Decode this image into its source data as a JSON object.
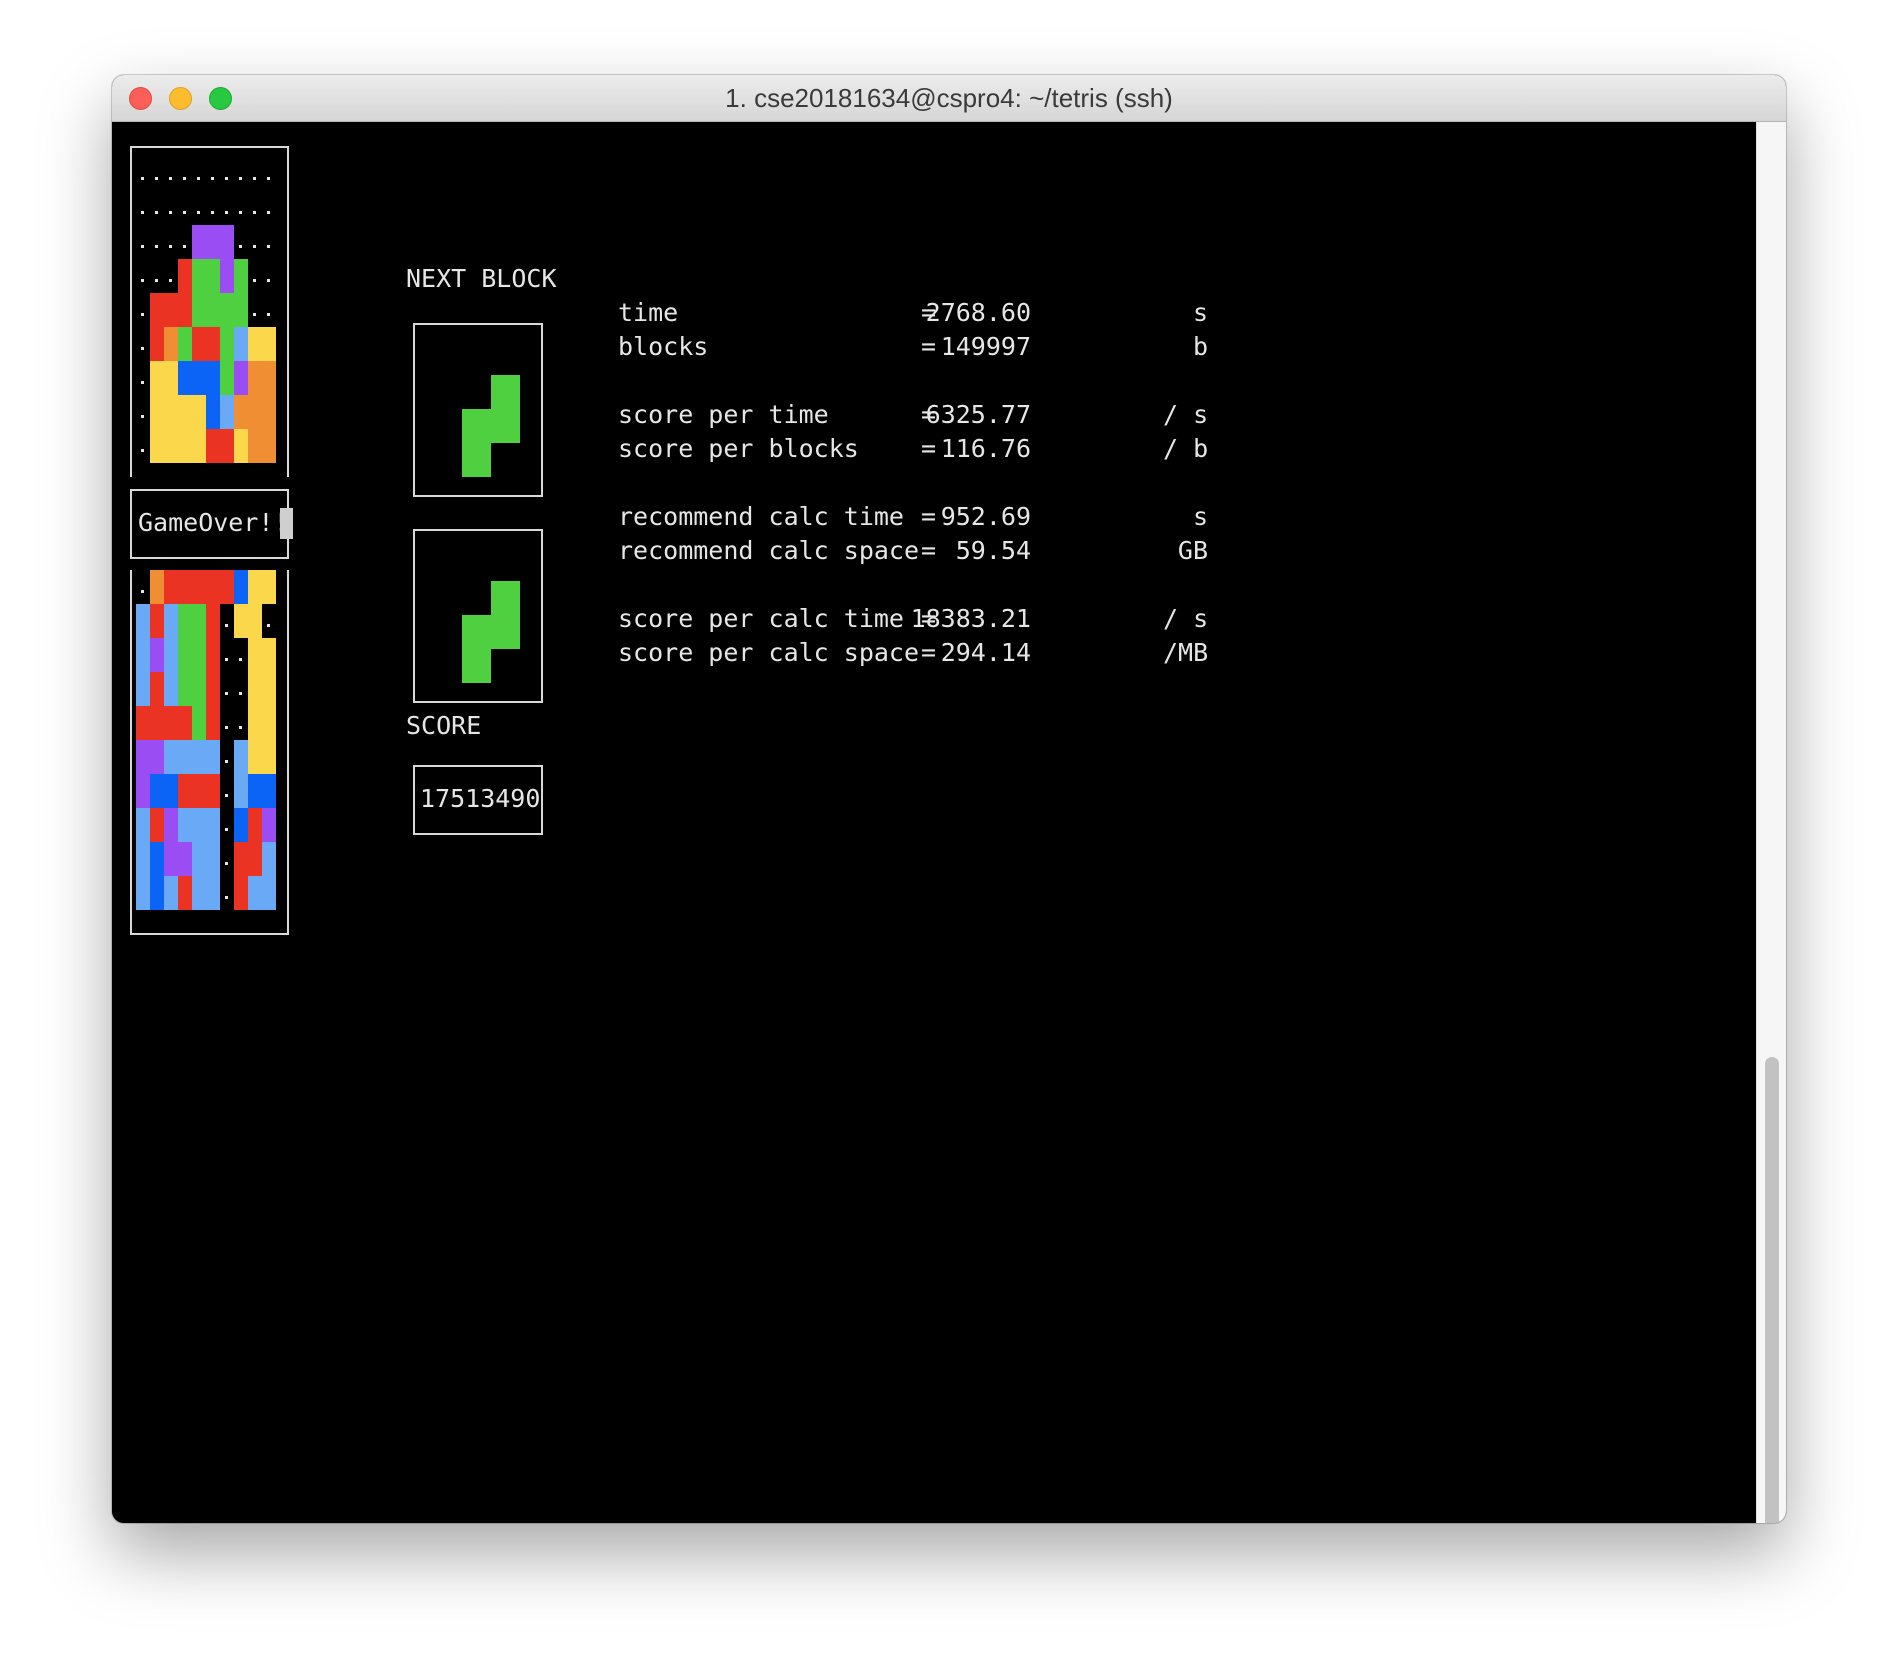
{
  "window": {
    "title": "1. cse20181634@cspro4: ~/tetris (ssh)"
  },
  "colors": {
    "R": "#ea3323",
    "O": "#f08e34",
    "Y": "#fbd84b",
    "G": "#4ed040",
    "B": "#0b64f6",
    "L": "#6aa9f6",
    "P": "#9a4df3",
    "terminal_bg": "#000000",
    "terminal_fg": "#e6e6e6"
  },
  "board_top": {
    "rows": [
      "..........",
      "..........",
      "....PPP...",
      "...RGGPG..",
      ".RRRGGGG..",
      ".ROGRRGLYY",
      ".YYBBBGPOO",
      ".YYYYBLOOO",
      ".YYYYRRYOO"
    ]
  },
  "game_over_label": "GameOver!!",
  "board_bottom": {
    "rows": [
      ".ORRRRRBYY",
      "LRLGGR.YY.",
      "LPLGGR..YY",
      "LRLGGR..YY",
      "RRRRGR..YY",
      "PPLLLL.LYY",
      "PBBRRR.LBB",
      "LRPLLL.BRP",
      "LBPPLL.RRL",
      "LBLRLL.RLL"
    ]
  },
  "next_block_label": "NEXT BLOCK",
  "next_blocks": [
    {
      "shape": [
        ".G",
        "GG",
        "G."
      ],
      "color": "G"
    },
    {
      "shape": [
        ".G",
        "GG",
        "G."
      ],
      "color": "G"
    }
  ],
  "score_label": "SCORE",
  "score_value": "17513490",
  "stats": [
    {
      "label": "time",
      "eq": "=",
      "value": "2768.60",
      "unit": "s"
    },
    {
      "label": "blocks",
      "eq": "=",
      "value": "149997",
      "unit": "b"
    },
    {
      "label": "score per time",
      "eq": "=",
      "value": "6325.77",
      "unit": "/ s"
    },
    {
      "label": "score per blocks",
      "eq": "=",
      "value": "116.76",
      "unit": "/ b"
    },
    {
      "label": "recommend calc time",
      "eq": "=",
      "value": "952.69",
      "unit": "s"
    },
    {
      "label": "recommend calc space",
      "eq": "=",
      "value": "59.54",
      "unit": "GB"
    },
    {
      "label": "score per calc time",
      "eq": "=",
      "value": "18383.21",
      "unit": "/ s"
    },
    {
      "label": "score per calc space",
      "eq": "=",
      "value": "294.14",
      "unit": "/MB"
    }
  ]
}
